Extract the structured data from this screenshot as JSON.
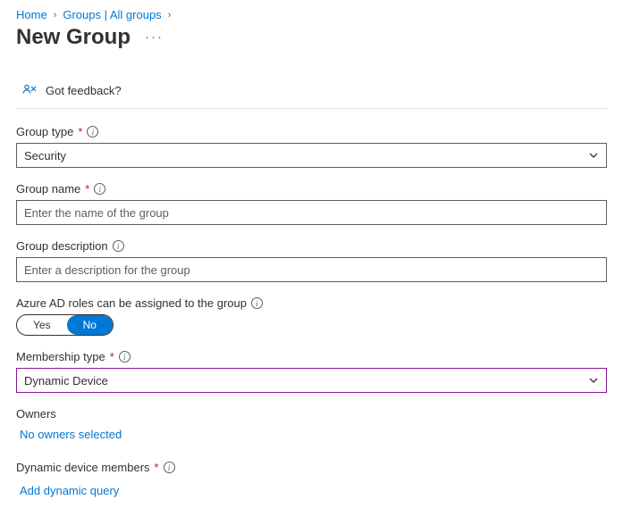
{
  "breadcrumb": {
    "home": "Home",
    "groups": "Groups | All groups"
  },
  "page_title": "New Group",
  "feedback": "Got feedback?",
  "fields": {
    "group_type": {
      "label": "Group type",
      "value": "Security"
    },
    "group_name": {
      "label": "Group name",
      "placeholder": "Enter the name of the group"
    },
    "group_desc": {
      "label": "Group description",
      "placeholder": "Enter a description for the group"
    },
    "aad_roles": {
      "label": "Azure AD roles can be assigned to the group",
      "yes": "Yes",
      "no": "No"
    },
    "membership_type": {
      "label": "Membership type",
      "value": "Dynamic Device"
    },
    "owners": {
      "label": "Owners",
      "link": "No owners selected"
    },
    "dynamic_members": {
      "label": "Dynamic device members",
      "link": "Add dynamic query"
    }
  }
}
